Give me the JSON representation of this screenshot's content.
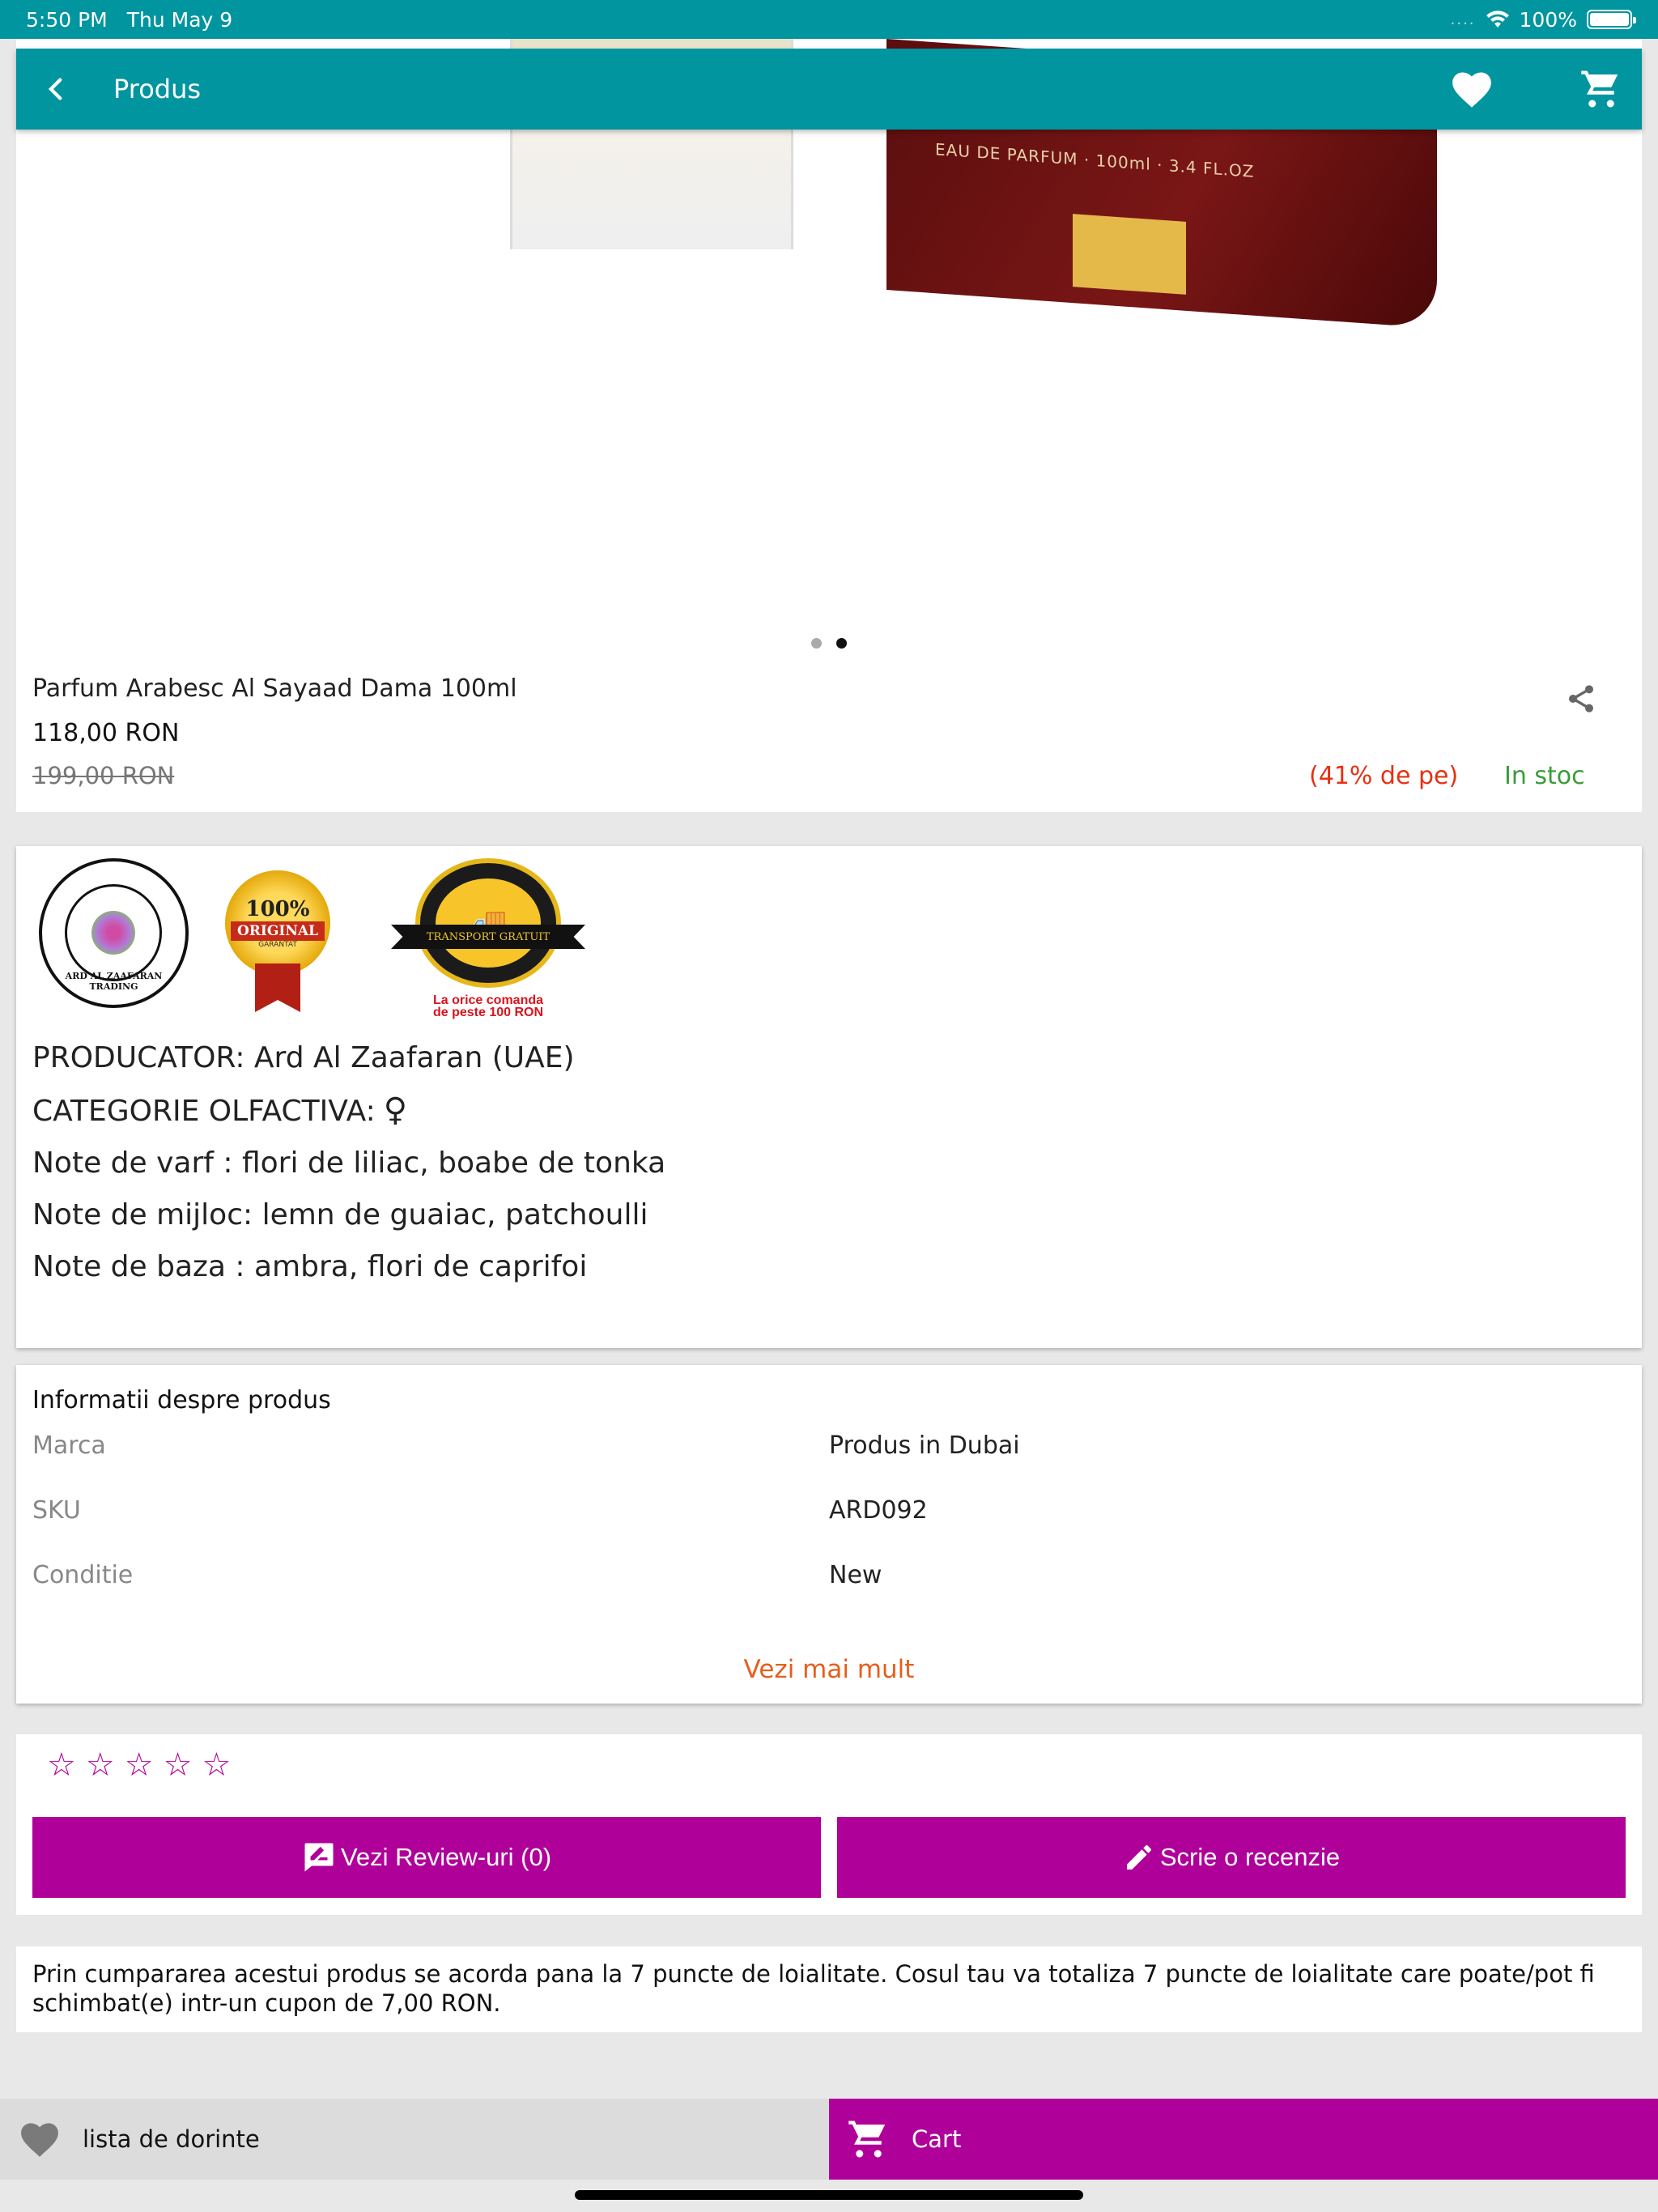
{
  "status_bar": {
    "time": "5:50 PM",
    "date": "Thu May 9",
    "signal": "....",
    "battery": "100%"
  },
  "app_bar": {
    "title": "Produs",
    "icons": [
      "back-arrow-icon",
      "heart-icon",
      "cart-icon"
    ]
  },
  "gallery": {
    "page_count": 2,
    "active_page": 2
  },
  "product": {
    "title": "Parfum Arabesc Al Sayaad Dama 100ml",
    "price": "118,00 RON",
    "old_price": "199,00 RON",
    "discount": "(41% de pe)",
    "stock": "In stoc"
  },
  "badges": {
    "logo_text": "ARD AL ZAAFARAN TRADING",
    "original_big": "100%",
    "original_band": "ORIGINAL",
    "original_small": "GARANTAT",
    "transport_strip": "TRANSPORT GRATUIT",
    "transport_note_1": "La orice comanda",
    "transport_note_2": "de peste 100 RON"
  },
  "description": {
    "producer": "PRODUCATOR: Ard Al Zaafaran (UAE)",
    "category": "CATEGORIE OLFACTIVA:",
    "category_icon": "♀",
    "top_notes": "Note de varf : flori de liliac, boabe de tonka",
    "middle_notes": "Note de mijloc: lemn de guaiac, patchoulli",
    "base_notes": "Note de baza : ambra, flori de caprifoi"
  },
  "info": {
    "title": "Informatii despre produs",
    "rows": [
      {
        "key": "Marca",
        "value": "Produs in Dubai"
      },
      {
        "key": "SKU",
        "value": "ARD092"
      },
      {
        "key": "Conditie",
        "value": "New"
      }
    ],
    "more_label": "Vezi mai mult"
  },
  "reviews": {
    "rating": 0,
    "max_rating": 5,
    "view_label": "Vezi Review-uri (0)",
    "write_label": "Scrie o recenzie"
  },
  "loyalty_text": "Prin cumpararea acestui produs se acorda pana la 7 puncte de loialitate. Cosul tau va totaliza 7 puncte de loialitate care poate/pot fi schimbat(e) intr-un cupon de 7,00 RON.",
  "bottom_bar": {
    "wishlist_label": "lista de dorinte",
    "cart_label": "Cart"
  },
  "colors": {
    "teal": "#00959f",
    "magenta": "#b0009a",
    "discount_red": "#e53212",
    "stock_green": "#3a9c3a",
    "link_orange": "#e85d1c"
  }
}
